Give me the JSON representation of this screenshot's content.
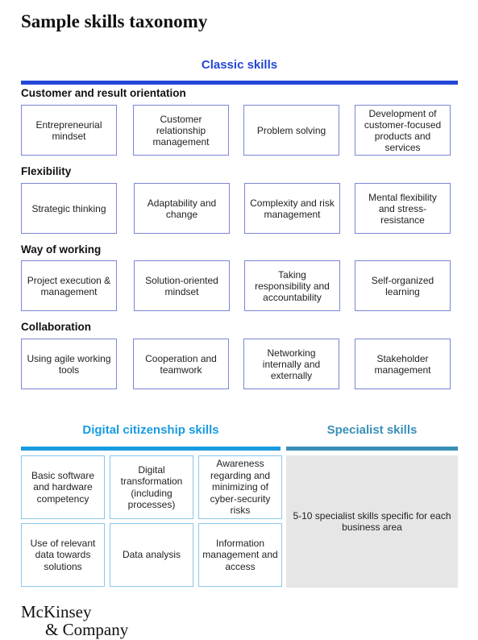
{
  "title": "Sample skills taxonomy",
  "classic": {
    "header": "Classic skills",
    "color": "#2347d8",
    "groups": [
      {
        "label": "Customer and result orientation",
        "items": [
          "Entrepreneurial mindset",
          "Customer relationship management",
          "Problem solving",
          "Development of customer-focused products and services"
        ]
      },
      {
        "label": "Flexibility",
        "items": [
          "Strategic thinking",
          "Adaptability and change",
          "Complexity and risk management",
          "Mental flexibility and stress-resistance"
        ]
      },
      {
        "label": "Way of working",
        "items": [
          "Project execution & management",
          "Solution-oriented mindset",
          "Taking responsibility and accountability",
          "Self-organized learning"
        ]
      },
      {
        "label": "Collaboration",
        "items": [
          "Using agile working tools",
          "Cooperation and teamwork",
          "Networking internally and externally",
          "Stakeholder management"
        ]
      }
    ]
  },
  "digital": {
    "header": "Digital citizenship skills",
    "color": "#1a9be0",
    "items": [
      "Basic software and hardware competency",
      "Digital transformation (including processes)",
      "Awareness regarding and minimizing of cyber-security risks",
      "Use of relevant data towards solutions",
      "Data analysis",
      "Information management and access"
    ]
  },
  "specialist": {
    "header": "Specialist skills",
    "color": "#3a8fb7",
    "text": "5-10 specialist skills specific for each business area"
  },
  "logo": {
    "line1": "McKinsey",
    "line2": "& Company"
  }
}
